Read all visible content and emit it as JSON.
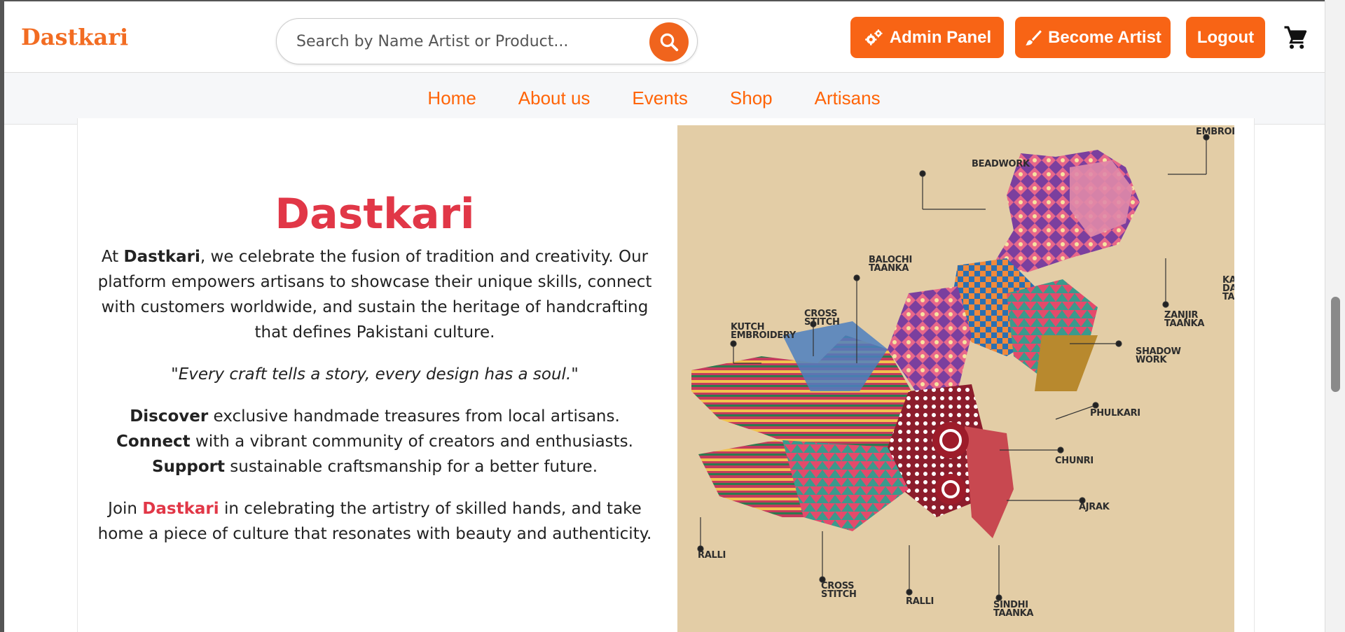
{
  "header": {
    "logo": "Dastkari",
    "search_placeholder": "Search by Name Artist or Product...",
    "buttons": {
      "admin": "Admin Panel",
      "become_artist": "Become Artist",
      "logout": "Logout"
    },
    "icons": [
      "search-icon",
      "gears-icon",
      "brush-icon",
      "cart-icon"
    ]
  },
  "nav": {
    "items": [
      "Home",
      "About us",
      "Events",
      "Shop",
      "Artisans"
    ]
  },
  "about": {
    "title": "Dastkari",
    "para1_prefix": "At ",
    "para1_brand": "Dastkari",
    "para1_suffix": ", we celebrate the fusion of tradition and creativity. Our platform empowers artisans to showcase their unique skills, connect with customers worldwide, and sustain the heritage of handcrafting that defines Pakistani culture.",
    "quote": "\"Every craft tells a story, every design has a soul.\"",
    "features": [
      {
        "bold": "Discover",
        "text": " exclusive handmade treasures from local artisans."
      },
      {
        "bold": "Connect",
        "text": " with a vibrant community of creators and enthusiasts."
      },
      {
        "bold": "Support",
        "text": " sustainable craftsmanship for a better future."
      }
    ],
    "join_prefix": "Join ",
    "join_brand": "Dastkari",
    "join_suffix": " in celebrating the artistry of skilled hands, and take home a piece of culture that resonates with beauty and authenticity."
  },
  "map": {
    "labels": {
      "embroi": "EMBROI",
      "beadwork": "BEADWORK",
      "balochi_taanka": "BALOCHI TAANKA",
      "cross_stitch_1": "CROSS STITCH",
      "kutch_embroidery": "KUTCH EMBROIDERY",
      "zanjir_taanka": "ZANJIR TAANKA",
      "kas_da_taa": "KAS DA TAA",
      "shadow_work": "SHADOW WORK",
      "phulkari": "PHULKARI",
      "chunri": "CHUNRI",
      "ajrak": "AJRAK",
      "ralli_1": "RALLI",
      "cross_stitch_2": "CROSS STITCH",
      "ralli_2": "RALLI",
      "sindhi_taanka": "SINDHI TAANKA"
    }
  },
  "colors": {
    "accent_orange": "#f86415",
    "brand_red": "#e13747",
    "map_background": "#e3cda6"
  }
}
